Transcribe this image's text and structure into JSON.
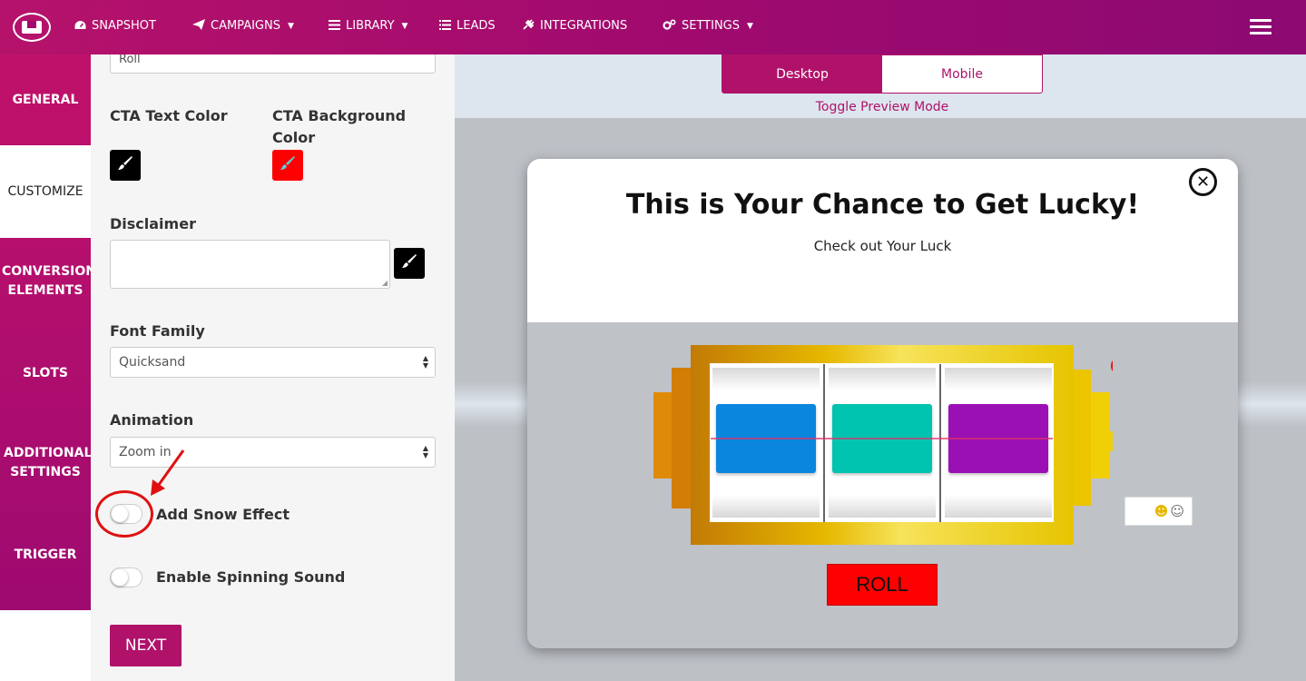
{
  "nav": {
    "items": [
      {
        "label": "SNAPSHOT",
        "icon": "dashboard-icon",
        "caret": false
      },
      {
        "label": "CAMPAIGNS",
        "icon": "paper-plane-icon",
        "caret": true
      },
      {
        "label": "LIBRARY",
        "icon": "library-icon",
        "caret": true
      },
      {
        "label": "LEADS",
        "icon": "list-icon",
        "caret": false
      },
      {
        "label": "INTEGRATIONS",
        "icon": "plug-icon",
        "caret": false
      },
      {
        "label": "SETTINGS",
        "icon": "cogs-icon",
        "caret": true
      }
    ]
  },
  "sidebar": {
    "items": [
      {
        "label": "GENERAL",
        "active": false
      },
      {
        "label": "CUSTOMIZE",
        "active": true
      },
      {
        "label": "CONVERSION ELEMENTS",
        "active": false
      },
      {
        "label": "SLOTS",
        "active": false
      },
      {
        "label": "ADDITIONAL SETTINGS",
        "active": false
      },
      {
        "label": "TRIGGER",
        "active": false
      }
    ]
  },
  "form": {
    "cta_text_value": "Roll",
    "cta_text_color_label": "CTA Text Color",
    "cta_bg_color_label": "CTA Background Color",
    "cta_text_color": "#000000",
    "cta_bg_color": "#ff0000",
    "disclaimer_label": "Disclaimer",
    "disclaimer_value": "",
    "font_family_label": "Font Family",
    "font_family_value": "Quicksand",
    "animation_label": "Animation",
    "animation_value": "Zoom in",
    "snow_label": "Add Snow Effect",
    "snow_on": false,
    "sound_label": "Enable Spinning Sound",
    "sound_on": false,
    "next_label": "NEXT"
  },
  "preview": {
    "mode_desktop": "Desktop",
    "mode_mobile": "Mobile",
    "mode_active": "Desktop",
    "mode_caption": "Toggle Preview Mode",
    "popup_title": "This is Your Chance to Get Lucky!",
    "popup_subtitle": "Check out Your Luck",
    "roll_label": "ROLL",
    "reel_colors": [
      "#0b86de",
      "#00c4b0",
      "#9b10b4"
    ],
    "accent_color": "#b0126a"
  }
}
